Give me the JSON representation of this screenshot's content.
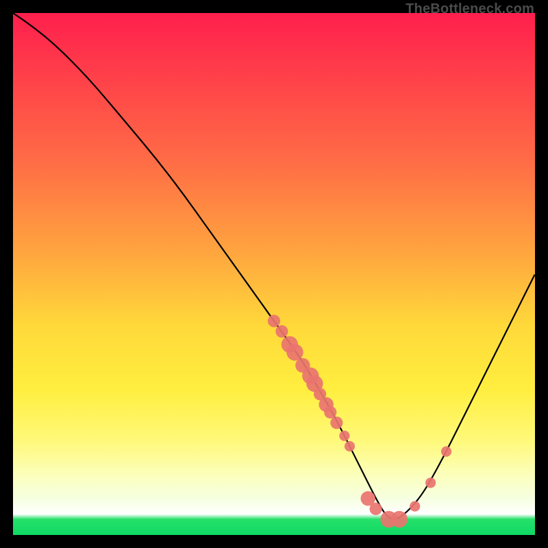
{
  "watermark": "TheBottleneck.com",
  "colors": {
    "top": "#ff1f4d",
    "mid_orange": "#ffa23f",
    "yellow": "#ffee3f",
    "green": "#0fd964",
    "curve": "#000000",
    "dot": "#e9746f",
    "frame": "#000000"
  },
  "chart_data": {
    "type": "line",
    "title": "",
    "xlabel": "",
    "ylabel": "",
    "xlim": [
      0,
      100
    ],
    "ylim": [
      0,
      100
    ],
    "grid": false,
    "legend": false,
    "note": "Axes are unlabeled in the source image. The single black series is a bottleneck-style curve: high on the left, descending to a minimum near x≈72, then rising on the right. Scatter dots lie on the curve. Values below are positions estimated from the image on a 0–100 scale (x right, y up).",
    "series": [
      {
        "name": "curve",
        "x": [
          0,
          3,
          8,
          14,
          20,
          30,
          40,
          50,
          55,
          58,
          62,
          66,
          70,
          72,
          74,
          78,
          82,
          86,
          90,
          95,
          100
        ],
        "y": [
          100,
          98,
          94,
          88,
          81,
          69,
          55,
          41,
          34,
          29,
          22,
          14,
          6,
          3,
          3,
          7,
          14,
          22,
          30,
          40,
          50
        ]
      }
    ],
    "scatter": {
      "name": "dots",
      "points": [
        {
          "x": 50.0,
          "y": 41.0,
          "r": 1.2
        },
        {
          "x": 51.5,
          "y": 39.0,
          "r": 1.2
        },
        {
          "x": 53.0,
          "y": 36.5,
          "r": 1.6
        },
        {
          "x": 54.0,
          "y": 35.0,
          "r": 1.6
        },
        {
          "x": 55.5,
          "y": 32.5,
          "r": 1.4
        },
        {
          "x": 57.0,
          "y": 30.5,
          "r": 1.6
        },
        {
          "x": 57.8,
          "y": 29.0,
          "r": 1.6
        },
        {
          "x": 58.8,
          "y": 27.0,
          "r": 1.2
        },
        {
          "x": 60.0,
          "y": 25.0,
          "r": 1.4
        },
        {
          "x": 60.8,
          "y": 23.5,
          "r": 1.2
        },
        {
          "x": 62.0,
          "y": 21.5,
          "r": 1.2
        },
        {
          "x": 63.5,
          "y": 19.0,
          "r": 1.0
        },
        {
          "x": 64.5,
          "y": 17.0,
          "r": 1.0
        },
        {
          "x": 68.0,
          "y": 7.0,
          "r": 1.4
        },
        {
          "x": 69.5,
          "y": 5.0,
          "r": 1.2
        },
        {
          "x": 72.0,
          "y": 3.0,
          "r": 1.6
        },
        {
          "x": 74.0,
          "y": 3.0,
          "r": 1.6
        },
        {
          "x": 77.0,
          "y": 5.5,
          "r": 1.0
        },
        {
          "x": 80.0,
          "y": 10.0,
          "r": 1.0
        },
        {
          "x": 83.0,
          "y": 16.0,
          "r": 1.0
        }
      ]
    }
  }
}
